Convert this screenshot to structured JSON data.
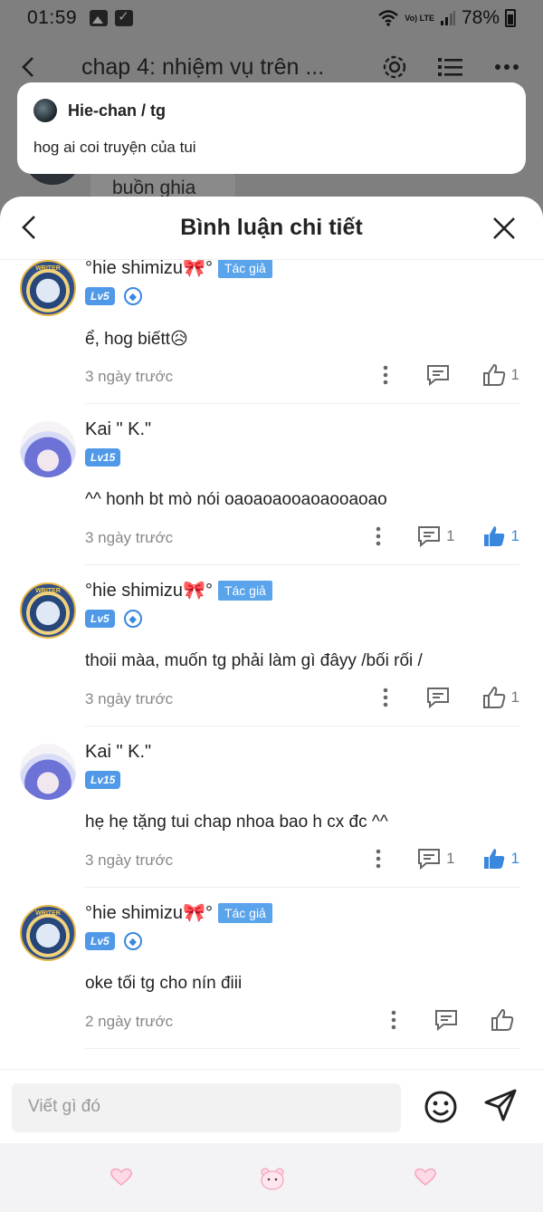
{
  "status_bar": {
    "time": "01:59",
    "battery": "78%",
    "network_label": "Vo) LTE"
  },
  "app_header": {
    "title": "chap 4: nhiệm vụ trên ..."
  },
  "background": {
    "snippet": "buồn ghia"
  },
  "notification": {
    "sender": "Hie-chan / tg",
    "message": "hog ai coi truyện của tui"
  },
  "sheet": {
    "title": "Bình luận chi tiết"
  },
  "comments": [
    {
      "author": "°hie shimizu🎀°",
      "author_tag": "Tác giả",
      "level": "Lv5",
      "text": "ể, hog biếtt😥",
      "time": "3 ngày trước",
      "reply_count": "",
      "like_count": "1",
      "liked": false
    },
    {
      "author": "Kai \" K.\"",
      "author_tag": "",
      "level": "Lv15",
      "text": "^^ honh bt mò nói oaoaoaooaoaooaoao",
      "time": "3 ngày trước",
      "reply_count": "1",
      "like_count": "1",
      "liked": true
    },
    {
      "author": "°hie shimizu🎀°",
      "author_tag": "Tác giả",
      "level": "Lv5",
      "text": "thoii màa, muốn tg phải làm gì đâyy /bối rối /",
      "time": "3 ngày trước",
      "reply_count": "",
      "like_count": "1",
      "liked": false
    },
    {
      "author": "Kai \" K.\"",
      "author_tag": "",
      "level": "Lv15",
      "text": "hẹ hẹ tặng tui chap nhoa bao h cx đc ^^",
      "time": "3 ngày trước",
      "reply_count": "1",
      "like_count": "1",
      "liked": true
    },
    {
      "author": "°hie shimizu🎀°",
      "author_tag": "Tác giả",
      "level": "Lv5",
      "text": "oke tối tg cho nín điii",
      "time": "2 ngày trước",
      "reply_count": "",
      "like_count": "",
      "liked": false
    }
  ],
  "input": {
    "placeholder": "Viết gì đó"
  },
  "colors": {
    "accent": "#3a87de",
    "author_tag": "#5aa4ec",
    "overlay": "#7f7f7f"
  }
}
